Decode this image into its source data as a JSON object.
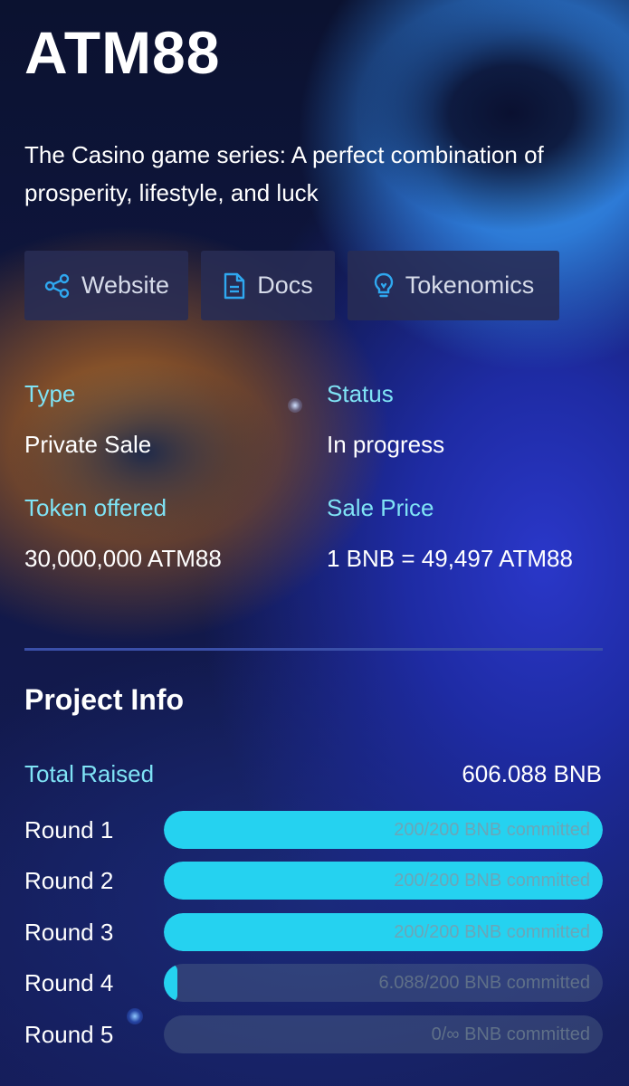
{
  "project": {
    "name": "ATM88",
    "description": "The Casino game series: A perfect combination of prosperity, lifestyle, and luck"
  },
  "links": [
    {
      "label": "Website",
      "icon": "share-icon"
    },
    {
      "label": "Docs",
      "icon": "document-icon"
    },
    {
      "label": "Tokenomics",
      "icon": "lightbulb-icon"
    }
  ],
  "info": {
    "type_label": "Type",
    "type_value": "Private Sale",
    "status_label": "Status",
    "status_value": "In progress",
    "token_label": "Token offered",
    "token_value": "30,000,000 ATM88",
    "price_label": "Sale Price",
    "price_value": "1 BNB = 49,497 ATM88"
  },
  "project_info": {
    "title": "Project Info",
    "total_label": "Total Raised",
    "total_value": "606.088 BNB",
    "rounds": [
      {
        "label": "Round 1",
        "committed": "200/200 BNB committed",
        "progress": 1.0
      },
      {
        "label": "Round 2",
        "committed": "200/200 BNB committed",
        "progress": 1.0
      },
      {
        "label": "Round 3",
        "committed": "200/200 BNB committed",
        "progress": 1.0
      },
      {
        "label": "Round 4",
        "committed": "6.088/200 BNB committed",
        "progress": 0.03044
      },
      {
        "label": "Round 5",
        "committed": "0/∞ BNB committed",
        "progress": 0
      }
    ]
  },
  "colors": {
    "accent": "#7fe3f5",
    "progress_fill": "#25d2f0",
    "button_bg": "#282c54"
  }
}
